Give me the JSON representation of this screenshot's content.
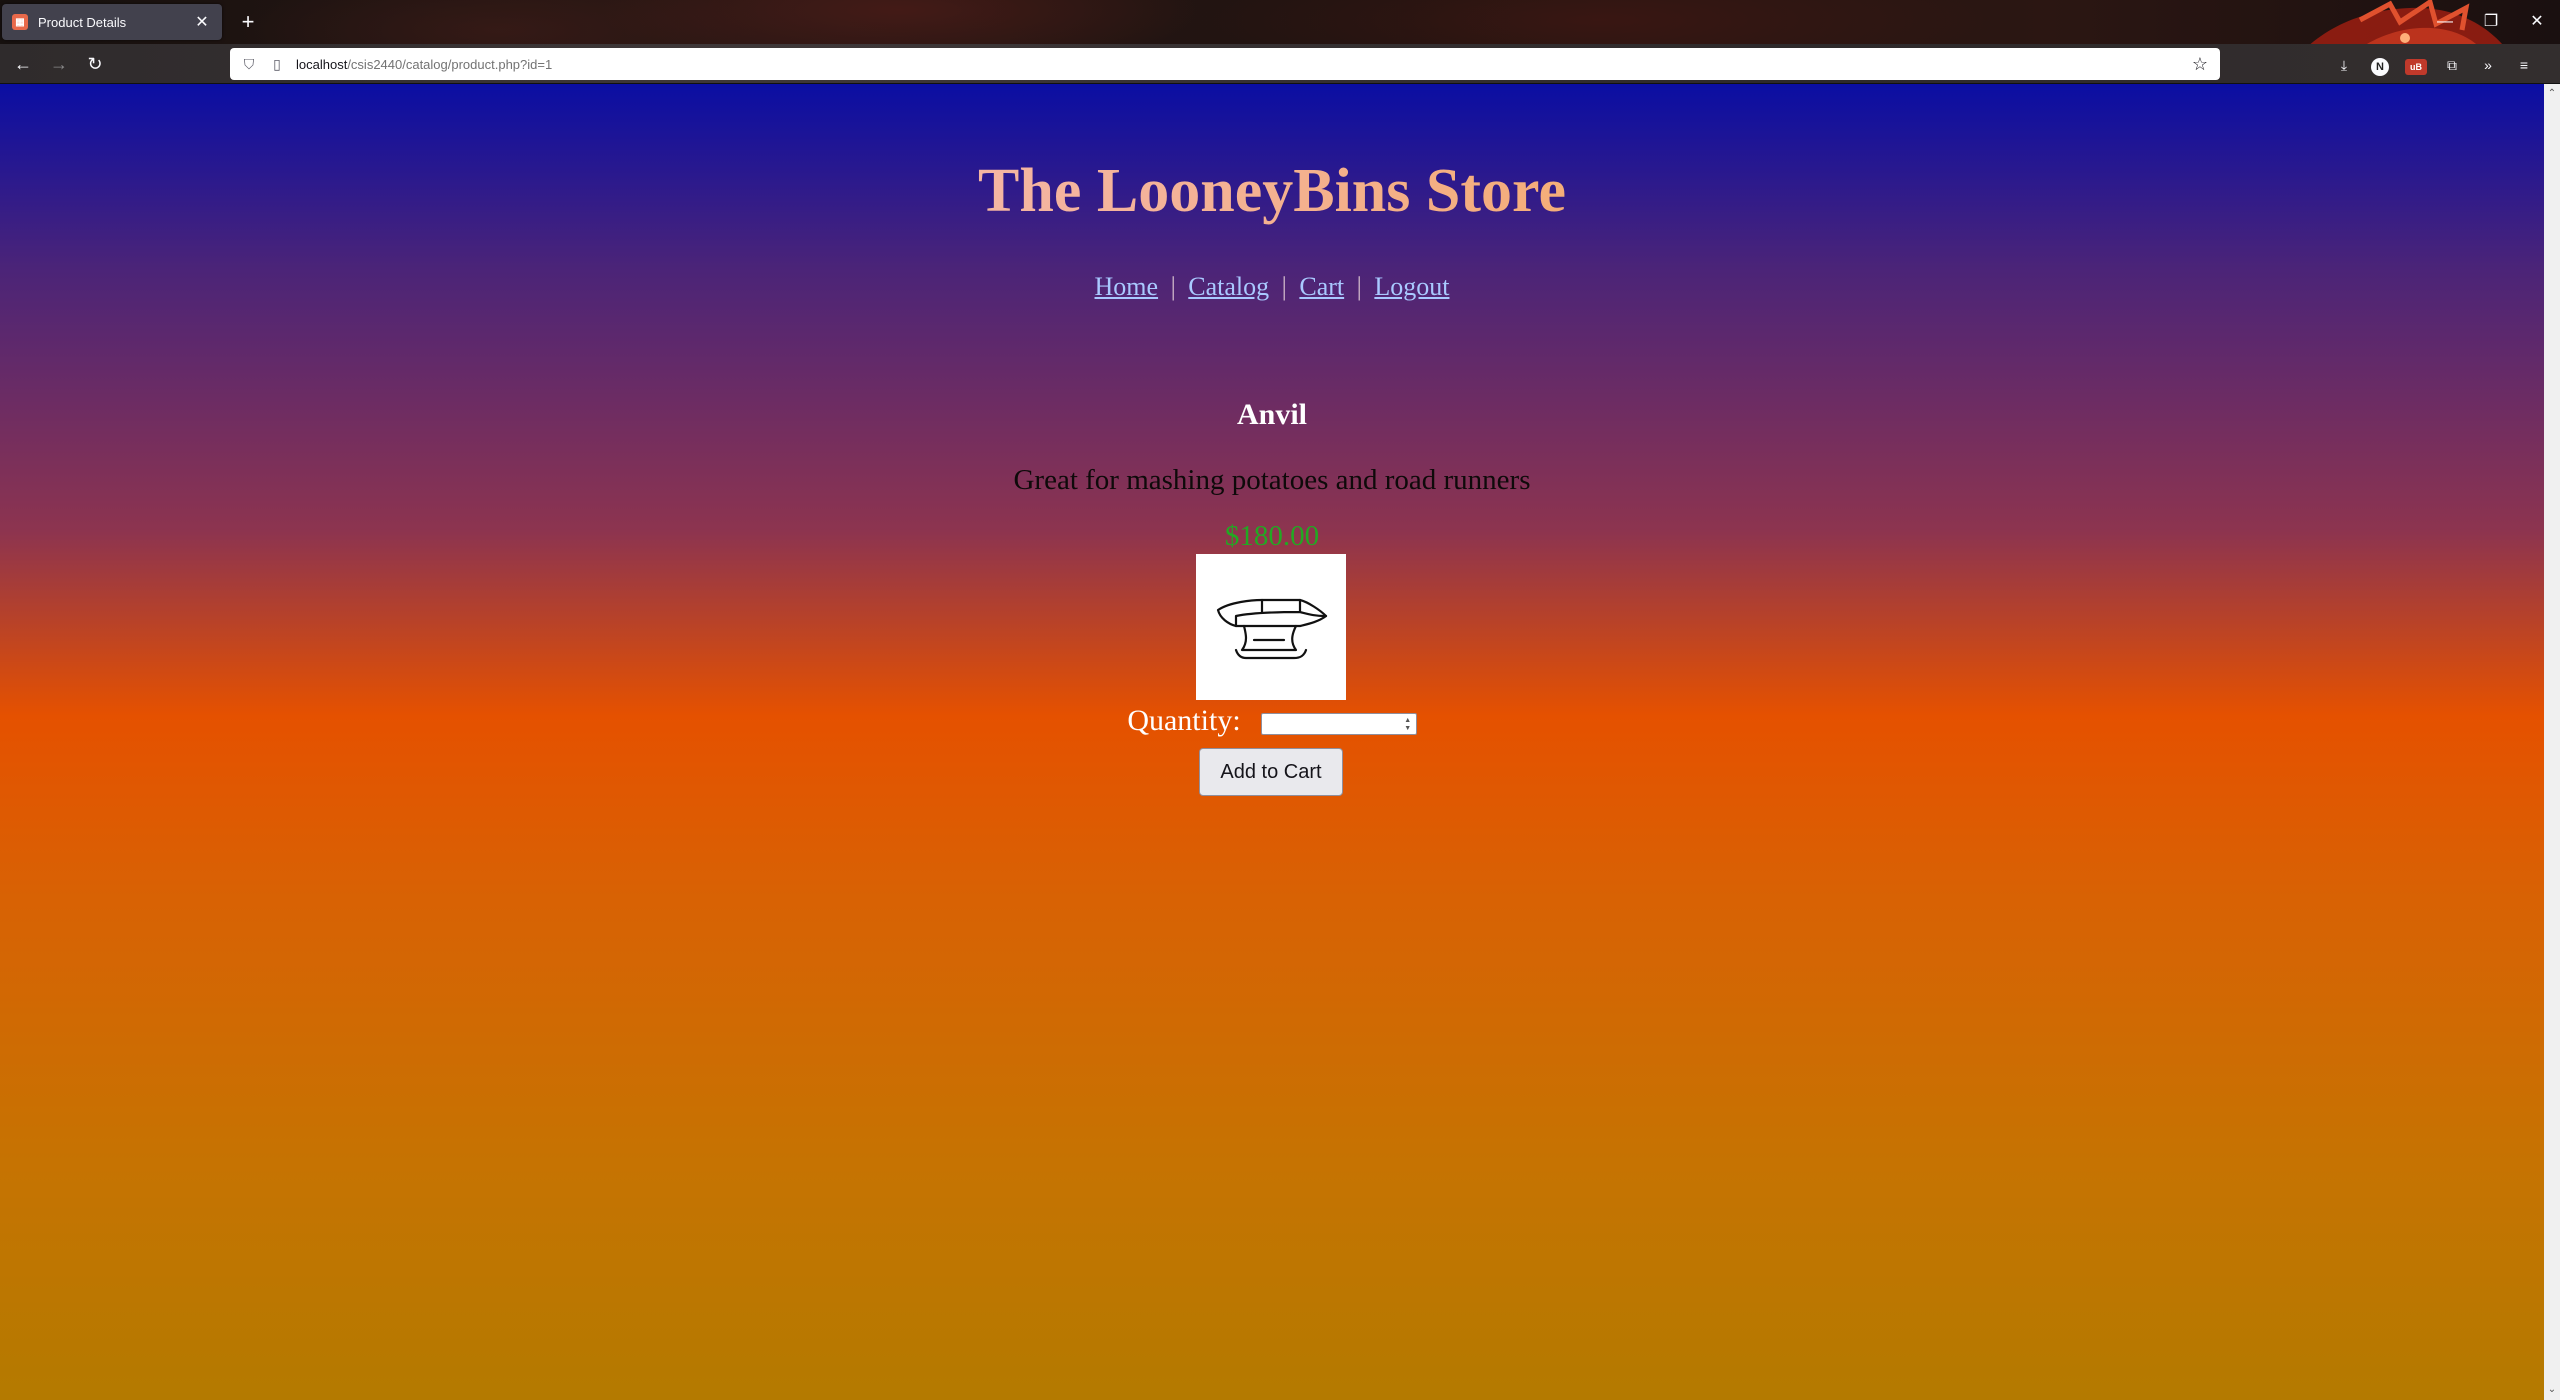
{
  "browser": {
    "tab_title": "Product Details",
    "tab_close": "✕",
    "new_tab": "+",
    "url_host": "localhost",
    "url_path": "/csis2440/catalog/product.php?id=1",
    "window_controls": {
      "minimize": "—",
      "restore": "❐",
      "close": "✕"
    }
  },
  "site": {
    "title": "The LooneyBins Store",
    "nav": {
      "home": "Home",
      "catalog": "Catalog",
      "cart": "Cart",
      "logout": "Logout",
      "separator": "|"
    }
  },
  "product": {
    "name": "Anvil",
    "description": "Great for mashing potatoes and road runners",
    "price": "$180.00",
    "image_icon": "anvil-icon",
    "quantity_label": "Quantity:",
    "quantity_value": "",
    "add_to_cart_label": "Add to Cart"
  },
  "colors": {
    "price": "#23a823",
    "link": "#a9c9ff",
    "gradient_top": "#0a0ea3",
    "gradient_mid": "#e55100",
    "gradient_bottom": "#b47a00"
  }
}
